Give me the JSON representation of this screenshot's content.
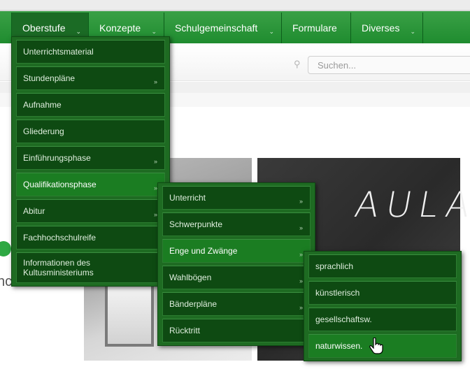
{
  "nav": {
    "items": [
      {
        "label": "Oberstufe",
        "has_submenu": true
      },
      {
        "label": "Konzepte",
        "has_submenu": true
      },
      {
        "label": "Schulgemeinschaft",
        "has_submenu": true
      },
      {
        "label": "Formulare",
        "has_submenu": false
      },
      {
        "label": "Diverses",
        "has_submenu": true
      }
    ]
  },
  "search": {
    "placeholder": "Suchen..."
  },
  "background": {
    "image_text": "AULA",
    "fragment_text": "nc"
  },
  "menu_oberstufe": [
    {
      "label": "Unterrichtsmaterial",
      "has_submenu": false
    },
    {
      "label": "Stundenpläne",
      "has_submenu": true
    },
    {
      "label": "Aufnahme",
      "has_submenu": false
    },
    {
      "label": "Gliederung",
      "has_submenu": false
    },
    {
      "label": "Einführungsphase",
      "has_submenu": true
    },
    {
      "label": "Qualifikationsphase",
      "has_submenu": true
    },
    {
      "label": "Abitur",
      "has_submenu": true
    },
    {
      "label": "Fachhochschulreife",
      "has_submenu": false
    },
    {
      "label": "Informationen des Kultusministeriums",
      "has_submenu": false
    }
  ],
  "menu_qualifikationsphase": [
    {
      "label": "Unterricht",
      "has_submenu": true
    },
    {
      "label": "Schwerpunkte",
      "has_submenu": true
    },
    {
      "label": "Enge und Zwänge",
      "has_submenu": true
    },
    {
      "label": "Wahlbögen",
      "has_submenu": true
    },
    {
      "label": "Bänderpläne",
      "has_submenu": true
    },
    {
      "label": "Rücktritt",
      "has_submenu": false
    }
  ],
  "menu_enge": [
    {
      "label": "sprachlich"
    },
    {
      "label": "künstlerisch"
    },
    {
      "label": "gesellschaftsw."
    },
    {
      "label": "naturwissen."
    }
  ],
  "icons": {
    "submenu_arrow": "»",
    "nav_chevron": "⌄",
    "search": "⚲"
  },
  "colors": {
    "nav_green": "#2a9a3b",
    "menu_bg": "#0e4a12",
    "menu_border": "#1e6b22"
  }
}
